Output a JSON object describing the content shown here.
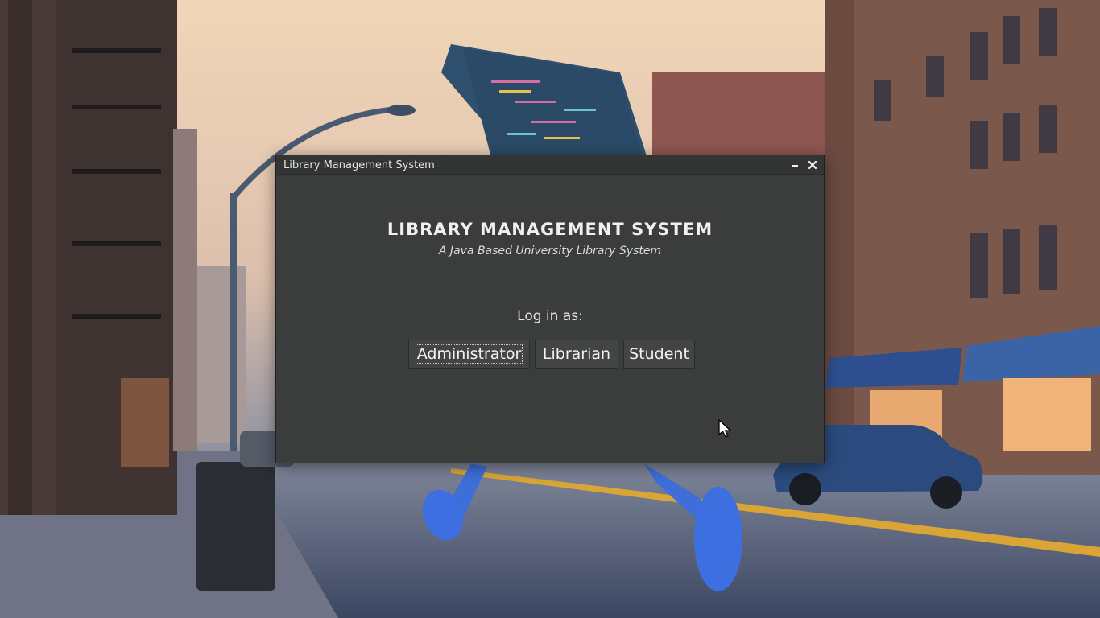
{
  "desktop": {
    "wallpaper_icon": "city-street-running-book-wallpaper"
  },
  "window": {
    "title": "Library Management System",
    "minimize_icon": "minimize-icon",
    "close_icon": "close-icon",
    "heading": "LIBRARY MANAGEMENT SYSTEM",
    "subheading": "A Java Based University Library System",
    "login_prompt": "Log in as:",
    "buttons": {
      "administrator": "Administrator",
      "librarian": "Librarian",
      "student": "Student"
    },
    "focused_button": "Administrator"
  },
  "colors": {
    "window_bg": "#3b3d3d",
    "titlebar_bg": "#333535",
    "button_bg": "#434545",
    "text": "#f0f0f0"
  }
}
